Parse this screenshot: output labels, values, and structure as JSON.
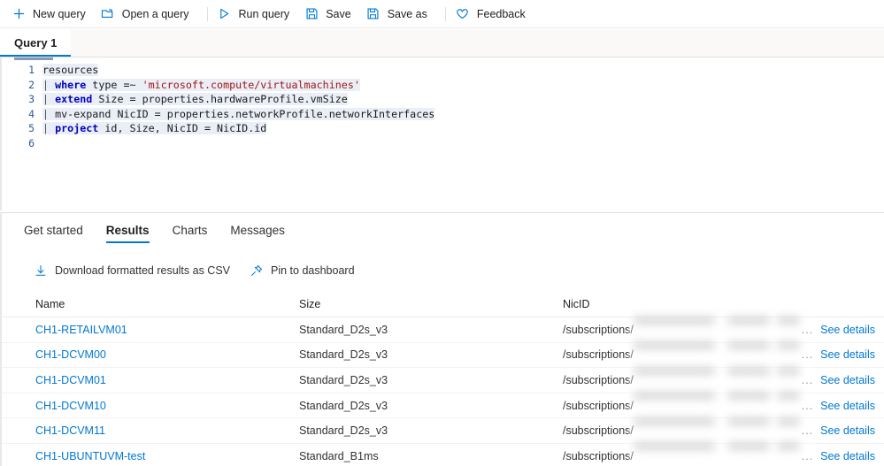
{
  "commandbar": {
    "items": [
      {
        "label": "New query",
        "icon": "plus-icon"
      },
      {
        "label": "Open a query",
        "icon": "folder-open-icon"
      },
      {
        "label": "Run query",
        "icon": "play-icon"
      },
      {
        "label": "Save",
        "icon": "save-icon"
      },
      {
        "label": "Save as",
        "icon": "save-as-icon"
      },
      {
        "label": "Feedback",
        "icon": "heart-icon"
      }
    ]
  },
  "query_tab": {
    "label": "Query 1"
  },
  "editor": {
    "lines": [
      {
        "number": "1",
        "segments": [
          {
            "t": "resources",
            "k": "plain"
          }
        ]
      },
      {
        "number": "2",
        "segments": [
          {
            "t": "| ",
            "k": "pipe"
          },
          {
            "t": "where",
            "k": "kw"
          },
          {
            "t": " type =~ ",
            "k": "plain"
          },
          {
            "t": "'microsoft.compute/virtualmachines'",
            "k": "str"
          }
        ]
      },
      {
        "number": "3",
        "segments": [
          {
            "t": "| ",
            "k": "pipe"
          },
          {
            "t": "extend",
            "k": "kw"
          },
          {
            "t": " Size = properties.hardwareProfile.vmSize",
            "k": "plain"
          }
        ]
      },
      {
        "number": "4",
        "segments": [
          {
            "t": "| ",
            "k": "pipe"
          },
          {
            "t": "mv-expand",
            "k": "plain"
          },
          {
            "t": " NicID = properties.networkProfile.networkInterfaces",
            "k": "plain"
          }
        ]
      },
      {
        "number": "5",
        "segments": [
          {
            "t": "| ",
            "k": "pipe"
          },
          {
            "t": "project",
            "k": "kw"
          },
          {
            "t": " id, Size, NicID = NicID.id",
            "k": "plain"
          }
        ]
      },
      {
        "number": "6",
        "segments": [
          {
            "t": "",
            "k": "plain"
          }
        ]
      }
    ]
  },
  "results": {
    "tabs": [
      {
        "label": "Get started",
        "active": false
      },
      {
        "label": "Results",
        "active": true
      },
      {
        "label": "Charts",
        "active": false
      },
      {
        "label": "Messages",
        "active": false
      }
    ],
    "actions": [
      {
        "label": "Download formatted results as CSV",
        "icon": "download-icon"
      },
      {
        "label": "Pin to dashboard",
        "icon": "pin-icon"
      }
    ],
    "columns": [
      "Name",
      "Size",
      "NicID"
    ],
    "details_link": "See details",
    "ellipsis": "...",
    "rows": [
      {
        "name": "CH1-RETAILVM01",
        "size": "Standard_D2s_v3",
        "nicid": "/subscriptions/"
      },
      {
        "name": "CH1-DCVM00",
        "size": "Standard_D2s_v3",
        "nicid": "/subscriptions/"
      },
      {
        "name": "CH1-DCVM01",
        "size": "Standard_D2s_v3",
        "nicid": "/subscriptions/"
      },
      {
        "name": "CH1-DCVM10",
        "size": "Standard_D2s_v3",
        "nicid": "/subscriptions/"
      },
      {
        "name": "CH1-DCVM11",
        "size": "Standard_D2s_v3",
        "nicid": "/subscriptions/"
      },
      {
        "name": "CH1-UBUNTUVM-test",
        "size": "Standard_B1ms",
        "nicid": "/subscriptions/"
      }
    ]
  },
  "colors": {
    "accent": "#0078d4",
    "link": "#0078d4",
    "text": "#201f1e",
    "keyword": "#0000c0",
    "string": "#a31515"
  }
}
